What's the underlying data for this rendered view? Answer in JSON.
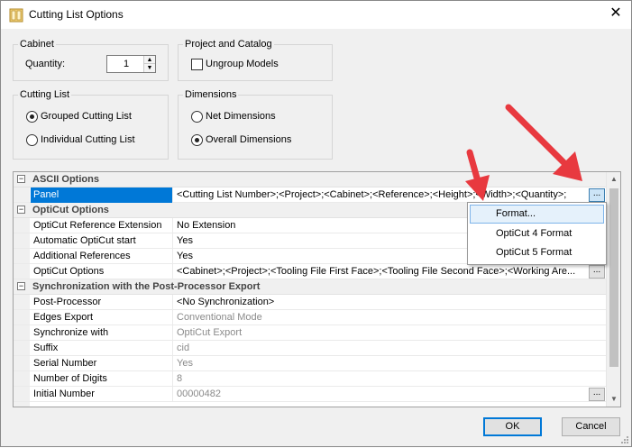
{
  "window": {
    "title": "Cutting List Options",
    "close_label": "✕"
  },
  "cabinet": {
    "title": "Cabinet",
    "quantity_label": "Quantity:",
    "quantity_value": "1"
  },
  "project_catalog": {
    "title": "Project and Catalog",
    "ungroup_label": "Ungroup Models",
    "ungroup_checked": false
  },
  "cutting_list": {
    "title": "Cutting List",
    "grouped_label": "Grouped Cutting List",
    "individual_label": "Individual Cutting List",
    "selected": "grouped"
  },
  "dimensions": {
    "title": "Dimensions",
    "net_label": "Net Dimensions",
    "overall_label": "Overall Dimensions",
    "selected": "overall"
  },
  "grid": {
    "ascii": {
      "title": "ASCII Options",
      "panel": {
        "name": "Panel",
        "value": "<Cutting List Number>;<Project>;<Cabinet>;<Reference>;<Height>;<Width>;<Quantity>;"
      }
    },
    "opticut": {
      "title": "OptiCut Options",
      "rows": [
        {
          "name": "OptiCut Reference Extension",
          "value": "No Extension"
        },
        {
          "name": "Automatic OptiCut start",
          "value": "Yes"
        },
        {
          "name": "Additional References",
          "value": "Yes"
        },
        {
          "name": "OptiCut Options",
          "value": "<Cabinet>;<Project>;<Tooling File First Face>;<Tooling File Second Face>;<Working Are..."
        }
      ]
    },
    "sync": {
      "title": "Synchronization with the Post-Processor Export",
      "rows": [
        {
          "name": "Post-Processor",
          "value": "<No Synchronization>"
        },
        {
          "name": "Edges Export",
          "value": "Conventional Mode"
        },
        {
          "name": "Synchronize with",
          "value": "OptiCut Export"
        },
        {
          "name": "Suffix",
          "value": "cid"
        },
        {
          "name": "Serial Number",
          "value": "Yes"
        },
        {
          "name": "Number of Digits",
          "value": "8"
        },
        {
          "name": "Initial Number",
          "value": "00000482"
        }
      ]
    },
    "ellipsis_label": "...",
    "toggle_label": "−"
  },
  "dropdown": {
    "items": [
      "Format...",
      "OptiCut 4 Format",
      "OptiCut 5 Format"
    ],
    "hovered": "Format..."
  },
  "buttons": {
    "ok": "OK",
    "cancel": "Cancel"
  },
  "colors": {
    "selection": "#0078d7",
    "arrow": "#e8393f",
    "dropdown_hover": "#e5f1fb"
  },
  "icons": {
    "title": "cutting-list-icon",
    "close": "close-icon",
    "annotation": "red-arrow-icon"
  }
}
